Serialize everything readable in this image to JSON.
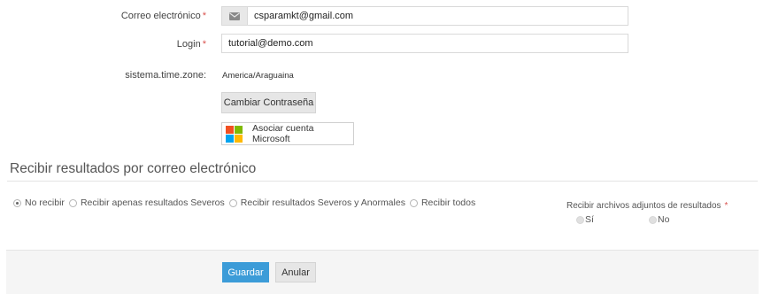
{
  "form": {
    "email": {
      "label": "Correo electrónico",
      "required_mark": "*",
      "value": "csparamkt@gmail.com",
      "icon": "envelope-icon"
    },
    "login": {
      "label": "Login",
      "required_mark": "*",
      "value": "tutorial@demo.com"
    },
    "timezone": {
      "label": "sistema.time.zone:",
      "value": "America/Araguaina"
    },
    "change_password_label": "Cambiar Contraseña",
    "microsoft_label": "Asociar cuenta Microsoft"
  },
  "results_section": {
    "title": "Recibir resultados por correo electrónico",
    "options": [
      {
        "label": "No recibir",
        "selected": true
      },
      {
        "label": "Recibir apenas resultados Severos",
        "selected": false
      },
      {
        "label": "Recibir resultados Severos y Anormales",
        "selected": false
      },
      {
        "label": "Recibir todos",
        "selected": false
      }
    ],
    "attachments": {
      "label": "Recibir archivos adjuntos de resultados",
      "required_mark": "*",
      "yes_label": "Sí",
      "no_label": "No"
    }
  },
  "footer": {
    "save_label": "Guardar",
    "cancel_label": "Anular"
  },
  "colors": {
    "primary": "#3c9cd8",
    "required": "#d9534f",
    "ms_red": "#f25022",
    "ms_green": "#7fba00",
    "ms_blue": "#00a4ef",
    "ms_yellow": "#ffb900"
  }
}
